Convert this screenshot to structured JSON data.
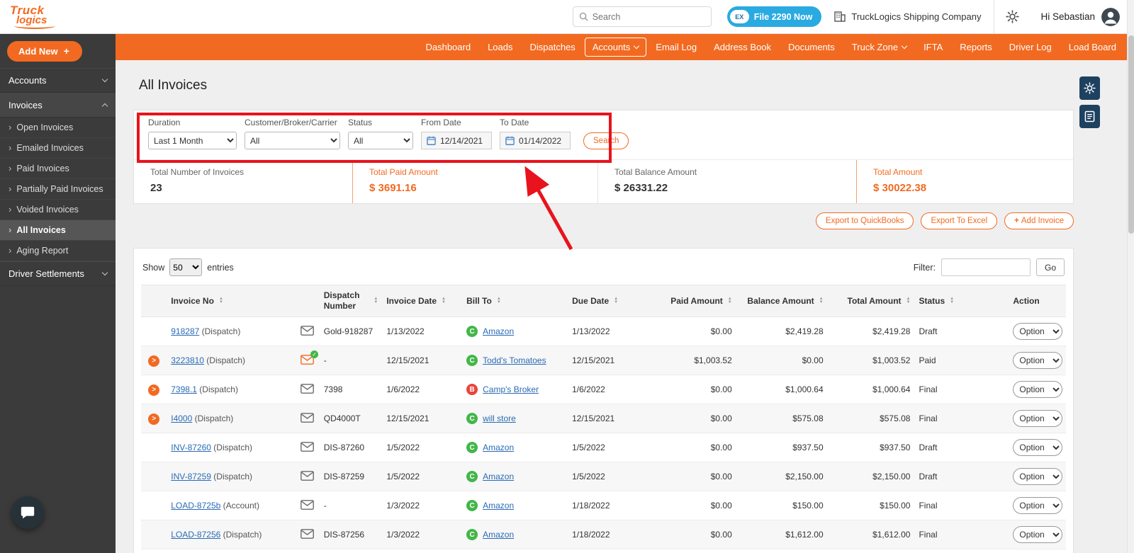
{
  "colors": {
    "brand_orange": "#f26a21",
    "link_blue": "#2a6bb5",
    "badge_green": "#43b649",
    "badge_red": "#e8453c",
    "file2290_blue": "#29aae1",
    "sidebar_dark": "#3b3b3b",
    "annotation_red": "#e8131c"
  },
  "topbar": {
    "logo_line1": "Truck",
    "logo_line2": "logics",
    "search_placeholder": "Search",
    "file2290_badge": "EX",
    "file2290_label": "File 2290 Now",
    "company_name": "TruckLogics Shipping Company",
    "greeting": "Hi Sebastian"
  },
  "nav": {
    "items": [
      {
        "label": "Dashboard",
        "active": false,
        "caret": false
      },
      {
        "label": "Loads",
        "active": false,
        "caret": false
      },
      {
        "label": "Dispatches",
        "active": false,
        "caret": false
      },
      {
        "label": "Accounts",
        "active": true,
        "caret": true
      },
      {
        "label": "Email Log",
        "active": false,
        "caret": false
      },
      {
        "label": "Address Book",
        "active": false,
        "caret": false
      },
      {
        "label": "Documents",
        "active": false,
        "caret": false
      },
      {
        "label": "Truck Zone",
        "active": false,
        "caret": true
      },
      {
        "label": "IFTA",
        "active": false,
        "caret": false
      },
      {
        "label": "Reports",
        "active": false,
        "caret": false
      },
      {
        "label": "Driver Log",
        "active": false,
        "caret": false
      },
      {
        "label": "Load Board",
        "active": false,
        "caret": false
      }
    ]
  },
  "sidebar": {
    "add_new_label": "Add New",
    "add_new_plus": "+",
    "groups": [
      {
        "label": "Accounts",
        "state": "collapsed",
        "items": []
      },
      {
        "label": "Invoices",
        "state": "expanded",
        "items": [
          {
            "label": "Open Invoices",
            "active": false
          },
          {
            "label": "Emailed Invoices",
            "active": false
          },
          {
            "label": "Paid Invoices",
            "active": false
          },
          {
            "label": "Partially Paid Invoices",
            "active": false
          },
          {
            "label": "Voided Invoices",
            "active": false
          },
          {
            "label": "All Invoices",
            "active": true
          },
          {
            "label": "Aging Report",
            "active": false
          }
        ]
      },
      {
        "label": "Driver Settlements",
        "state": "collapsed",
        "items": []
      }
    ]
  },
  "page": {
    "title": "All Invoices"
  },
  "filters": {
    "duration": {
      "label": "Duration",
      "value": "Last 1 Month"
    },
    "customer": {
      "label": "Customer/Broker/Carrier",
      "value": "All"
    },
    "status": {
      "label": "Status",
      "value": "All"
    },
    "from_date": {
      "label": "From Date",
      "value": "12/14/2021"
    },
    "to_date": {
      "label": "To Date",
      "value": "01/14/2022"
    },
    "search_button": "Search"
  },
  "summary": [
    {
      "label": "Total Number of Invoices",
      "value": "23",
      "orange": false
    },
    {
      "label": "Total Paid Amount",
      "value": "$ 3691.16",
      "orange": true
    },
    {
      "label": "Total Balance Amount",
      "value": "$ 26331.22",
      "orange": false
    },
    {
      "label": "Total Amount",
      "value": "$ 30022.38",
      "orange": true
    }
  ],
  "actions": {
    "export_quickbooks": "Export to QuickBooks",
    "export_excel": "Export To Excel",
    "add_invoice_plus": "+",
    "add_invoice": "Add Invoice"
  },
  "table": {
    "show_label": "Show",
    "page_size": "50",
    "entries_label": "entries",
    "filter_label": "Filter:",
    "go_button": "Go",
    "option_label": "Option",
    "columns": [
      {
        "label": "",
        "sortable": false
      },
      {
        "label": "Invoice No",
        "sortable": true
      },
      {
        "label": "",
        "sortable": false
      },
      {
        "label": "Dispatch Number",
        "sortable": true
      },
      {
        "label": "Invoice Date",
        "sortable": true
      },
      {
        "label": "Bill To",
        "sortable": true
      },
      {
        "label": "Due Date",
        "sortable": true
      },
      {
        "label": "Paid Amount",
        "sortable": true,
        "align": "right"
      },
      {
        "label": "Balance Amount",
        "sortable": true,
        "align": "right"
      },
      {
        "label": "Total Amount",
        "sortable": true,
        "align": "right"
      },
      {
        "label": "Status",
        "sortable": true
      },
      {
        "label": "Action",
        "sortable": false
      }
    ],
    "rows": [
      {
        "expandable": false,
        "invoice_no": "918287",
        "invoice_type": "(Dispatch)",
        "emailed": false,
        "dispatch_number": "Gold-918287",
        "invoice_date": "1/13/2022",
        "bill_to": "Amazon",
        "badge_letter": "C",
        "badge_color": "green",
        "due_date": "1/13/2022",
        "paid_amount": "$0.00",
        "balance_amount": "$2,419.28",
        "total_amount": "$2,419.28",
        "status": "Draft"
      },
      {
        "expandable": true,
        "invoice_no": "3223810",
        "invoice_type": "(Dispatch)",
        "emailed": true,
        "dispatch_number": "-",
        "invoice_date": "12/15/2021",
        "bill_to": "Todd's Tomatoes",
        "badge_letter": "C",
        "badge_color": "green",
        "due_date": "12/15/2021",
        "paid_amount": "$1,003.52",
        "balance_amount": "$0.00",
        "total_amount": "$1,003.52",
        "status": "Paid"
      },
      {
        "expandable": true,
        "invoice_no": "7398.1",
        "invoice_type": "(Dispatch)",
        "emailed": false,
        "dispatch_number": "7398",
        "invoice_date": "1/6/2022",
        "bill_to": "Camp's Broker",
        "badge_letter": "B",
        "badge_color": "red",
        "due_date": "1/6/2022",
        "paid_amount": "$0.00",
        "balance_amount": "$1,000.64",
        "total_amount": "$1,000.64",
        "status": "Final"
      },
      {
        "expandable": true,
        "invoice_no": "I4000",
        "invoice_type": "(Dispatch)",
        "emailed": false,
        "dispatch_number": "QD4000T",
        "invoice_date": "12/15/2021",
        "bill_to": "will store",
        "badge_letter": "C",
        "badge_color": "green",
        "due_date": "12/15/2021",
        "paid_amount": "$0.00",
        "balance_amount": "$575.08",
        "total_amount": "$575.08",
        "status": "Final"
      },
      {
        "expandable": false,
        "invoice_no": "INV-87260",
        "invoice_type": "(Dispatch)",
        "emailed": false,
        "dispatch_number": "DIS-87260",
        "invoice_date": "1/5/2022",
        "bill_to": "Amazon",
        "badge_letter": "C",
        "badge_color": "green",
        "due_date": "1/5/2022",
        "paid_amount": "$0.00",
        "balance_amount": "$937.50",
        "total_amount": "$937.50",
        "status": "Draft"
      },
      {
        "expandable": false,
        "invoice_no": "INV-87259",
        "invoice_type": "(Dispatch)",
        "emailed": false,
        "dispatch_number": "DIS-87259",
        "invoice_date": "1/5/2022",
        "bill_to": "Amazon",
        "badge_letter": "C",
        "badge_color": "green",
        "due_date": "1/5/2022",
        "paid_amount": "$0.00",
        "balance_amount": "$2,150.00",
        "total_amount": "$2,150.00",
        "status": "Draft"
      },
      {
        "expandable": false,
        "invoice_no": "LOAD-8725b",
        "invoice_type": "(Account)",
        "emailed": false,
        "dispatch_number": "-",
        "invoice_date": "1/3/2022",
        "bill_to": "Amazon",
        "badge_letter": "C",
        "badge_color": "green",
        "due_date": "1/18/2022",
        "paid_amount": "$0.00",
        "balance_amount": "$150.00",
        "total_amount": "$150.00",
        "status": "Final"
      },
      {
        "expandable": false,
        "invoice_no": "LOAD-87256",
        "invoice_type": "(Dispatch)",
        "emailed": false,
        "dispatch_number": "DIS-87256",
        "invoice_date": "1/3/2022",
        "bill_to": "Amazon",
        "badge_letter": "C",
        "badge_color": "green",
        "due_date": "1/18/2022",
        "paid_amount": "$0.00",
        "balance_amount": "$1,612.00",
        "total_amount": "$1,612.00",
        "status": "Final"
      }
    ]
  },
  "annotation": {
    "type": "red-box-with-arrow",
    "target": "filter-controls",
    "color": "#e8131c"
  }
}
